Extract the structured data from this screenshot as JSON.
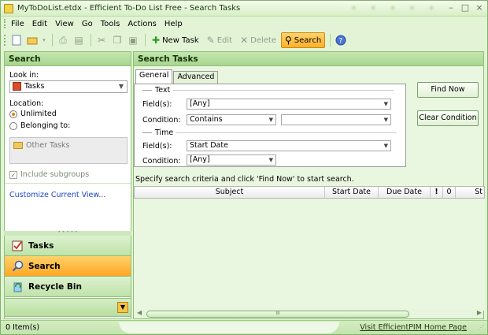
{
  "window": {
    "title": "MyToDoList.etdx - Efficient To-Do List Free - Search Tasks"
  },
  "menu": {
    "items": [
      "File",
      "Edit",
      "View",
      "Go",
      "Tools",
      "Actions",
      "Help"
    ]
  },
  "toolbar": {
    "new_task": "New Task",
    "edit": "Edit",
    "delete": "Delete",
    "search": "Search"
  },
  "left_pane": {
    "header": "Search",
    "look_in_label": "Look in:",
    "look_in_value": "Tasks",
    "location_label": "Location:",
    "location_options": [
      "Unlimited",
      "Belonging to:"
    ],
    "location_selected": "Unlimited",
    "other_tasks": "Other Tasks",
    "include_subgroups": "Include subgroups",
    "customize_link": "Customize Current View..."
  },
  "nav": {
    "items": [
      {
        "label": "Tasks",
        "icon": "tasks-icon",
        "active": false
      },
      {
        "label": "Search",
        "icon": "search-icon",
        "active": true
      },
      {
        "label": "Recycle Bin",
        "icon": "recycle-bin-icon",
        "active": false
      }
    ]
  },
  "right_pane": {
    "header": "Search Tasks",
    "tabs": [
      "General",
      "Advanced"
    ],
    "active_tab": "General",
    "text_group": "Text",
    "field_label_1": "Field(s):",
    "field_value_1": "[Any]",
    "condition_label_1": "Condition:",
    "condition_value_1": "Contains",
    "condition_text": "",
    "time_group": "Time",
    "field_label_2": "Field(s):",
    "field_value_2": "Start Date",
    "condition_label_2": "Condition:",
    "condition_value_2": "[Any]",
    "find_now": "Find Now",
    "clear_condition": "Clear Condition",
    "hint": "Specify search criteria and click 'Find Now' to start search."
  },
  "grid": {
    "columns": [
      "Subject",
      "Start Date",
      "Due Date",
      "!",
      "0",
      "St"
    ]
  },
  "status": {
    "count": "0 Item(s)",
    "link": "Visit EfficientPIM Home Page"
  }
}
